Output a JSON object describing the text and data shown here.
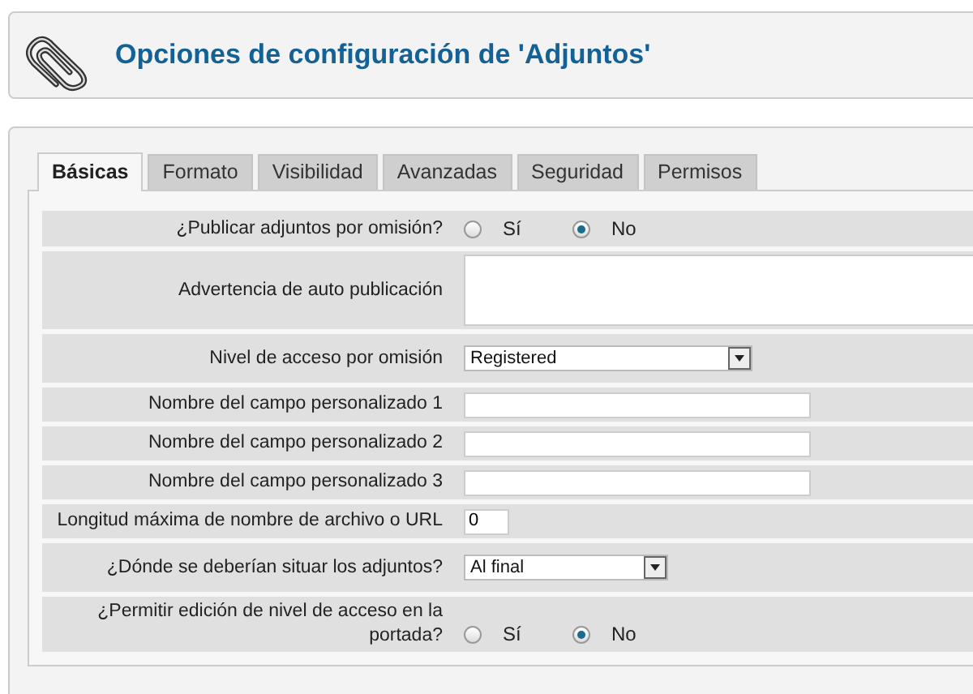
{
  "header": {
    "title": "Opciones de configuración de 'Adjuntos'"
  },
  "tabs": [
    {
      "label": "Básicas",
      "selected": true
    },
    {
      "label": "Formato",
      "selected": false
    },
    {
      "label": "Visibilidad",
      "selected": false
    },
    {
      "label": "Avanzadas",
      "selected": false
    },
    {
      "label": "Seguridad",
      "selected": false
    },
    {
      "label": "Permisos",
      "selected": false
    }
  ],
  "rows": [
    {
      "kind": "radio",
      "label": "¿Publicar adjuntos por omisión?",
      "options": [
        {
          "label": "Sí",
          "selected": false
        },
        {
          "label": "No",
          "selected": true
        }
      ]
    },
    {
      "kind": "textarea",
      "label": "Advertencia de auto publicación"
    },
    {
      "kind": "select",
      "label": "Nivel de acceso por omisión",
      "value": "Registered"
    },
    {
      "kind": "text",
      "label": "Nombre del campo personalizado 1"
    },
    {
      "kind": "text",
      "label": "Nombre del campo personalizado 2"
    },
    {
      "kind": "text",
      "label": "Nombre del campo personalizado 3"
    },
    {
      "kind": "number",
      "label": "Longitud máxima de nombre de archivo o URL",
      "value": "0"
    },
    {
      "kind": "shortselect",
      "label": "¿Dónde se deberían situar los adjuntos?",
      "value": "Al final"
    },
    {
      "kind": "radio",
      "label": "¿Permitir edición de nivel de acceso en la portada?",
      "options": [
        {
          "label": "Sí",
          "selected": false
        },
        {
          "label": "No",
          "selected": true
        }
      ]
    }
  ]
}
